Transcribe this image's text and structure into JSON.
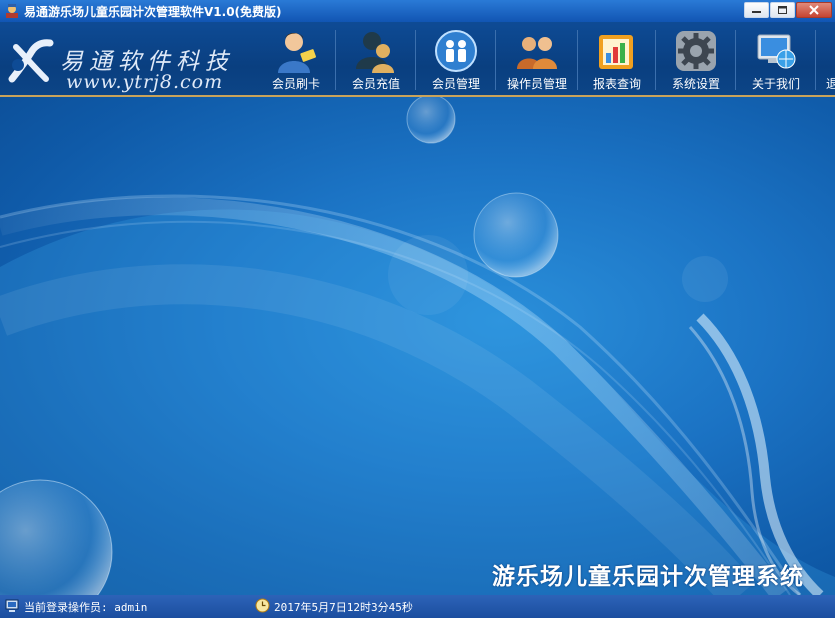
{
  "window": {
    "title": "易通游乐场儿童乐园计次管理软件V1.0(免费版)"
  },
  "logo": {
    "company_name": "易通软件科技",
    "website": "www.ytrj8.com"
  },
  "toolbar": {
    "items": [
      {
        "label": "会员刷卡",
        "icon": "member-card-swipe-icon"
      },
      {
        "label": "会员充值",
        "icon": "member-recharge-icon"
      },
      {
        "label": "会员管理",
        "icon": "member-manage-icon"
      },
      {
        "label": "操作员管理",
        "icon": "operator-manage-icon"
      },
      {
        "label": "报表查询",
        "icon": "report-query-icon"
      },
      {
        "label": "系统设置",
        "icon": "settings-gear-icon"
      },
      {
        "label": "关于我们",
        "icon": "about-us-globe-icon"
      },
      {
        "label": "退",
        "icon": "exit-icon"
      }
    ]
  },
  "desktop": {
    "brand_text": "游乐场儿童乐园计次管理系统"
  },
  "statusbar": {
    "operator_text": "当前登录操作员: admin",
    "datetime_text": "2017年5月7日12时3分45秒"
  },
  "colors": {
    "toolbar_bg": "#0c4587",
    "accent_rule": "#caa35a",
    "desktop_bg": "#1b73c4"
  }
}
